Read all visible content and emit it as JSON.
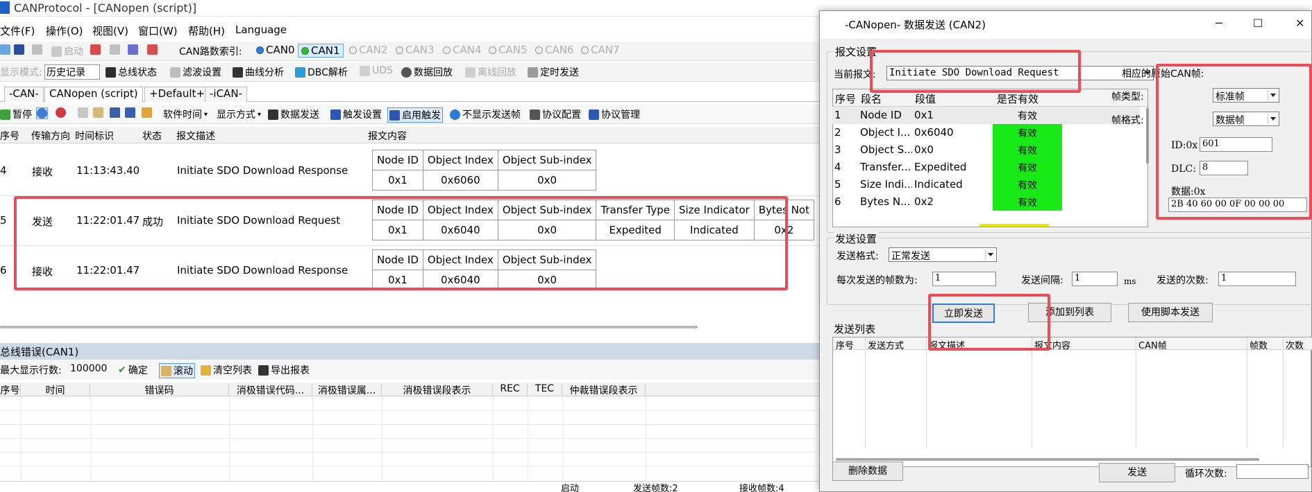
{
  "app": {
    "title": "CANProtocol - [CANopen (script)]"
  },
  "menu": {
    "file": "文件(F)",
    "operate": "操作(O)",
    "view": "视图(V)",
    "window": "窗口(W)",
    "help": "帮助(H)",
    "language": "Language"
  },
  "toolbar1": {
    "start": "启动",
    "can_index_label": "CAN路数索引:",
    "channels": [
      "CAN0",
      "CAN1",
      "CAN2",
      "CAN3",
      "CAN4",
      "CAN5",
      "CAN6",
      "CAN7"
    ]
  },
  "toolbar2": {
    "display_mode_label": "显示模式:",
    "display_mode_value": "历史记录",
    "bus_status": "总线状态",
    "filter": "滤波设置",
    "curve": "曲线分析",
    "dbc": "DBC解析",
    "uds": "UDS",
    "replay": "数据回放",
    "offline_replay": "离线回放",
    "timed_send": "定时发送"
  },
  "tabs": [
    "-CAN-",
    "CANopen (script)",
    "+Default+",
    "-iCAN-"
  ],
  "toolbar3": {
    "pause": "暂停",
    "soft_time": "软件时间",
    "display_method": "显示方式",
    "data_send": "数据发送",
    "trigger_settings": "触发设置",
    "enable_trigger": "启用触发",
    "hide_send_frames": "不显示发送帧",
    "protocol_config": "协议配置",
    "protocol_manage": "协议管理"
  },
  "main_table": {
    "headers": [
      "序号",
      "传输方向",
      "时间标识",
      "状态",
      "报文描述",
      "报文内容"
    ],
    "rows": [
      {
        "seq": "4",
        "dir": "接收",
        "time": "11:13:43.40",
        "status": "",
        "desc": "Initiate SDO Download Response",
        "fields": [
          "Node ID",
          "Object Index",
          "Object Sub-index"
        ],
        "values": [
          "0x1",
          "0x6060",
          "0x0"
        ]
      },
      {
        "seq": "5",
        "dir": "发送",
        "time": "11:22:01.47",
        "status": "成功",
        "desc": "Initiate SDO Download Request",
        "fields": [
          "Node ID",
          "Object Index",
          "Object Sub-index",
          "Transfer Type",
          "Size Indicator",
          "Bytes Not"
        ],
        "values": [
          "0x1",
          "0x6040",
          "0x0",
          "Expedited",
          "Indicated",
          "0x2"
        ]
      },
      {
        "seq": "6",
        "dir": "接收",
        "time": "11:22:01.47",
        "status": "",
        "desc": "Initiate SDO Download Response",
        "fields": [
          "Node ID",
          "Object Index",
          "Object Sub-index"
        ],
        "values": [
          "0x1",
          "0x6040",
          "0x0"
        ]
      }
    ]
  },
  "bus_error": {
    "title": "总线错误(CAN1)",
    "max_rows_label": "最大显示行数:",
    "max_rows_value": "100000",
    "confirm": "确定",
    "scroll": "滚动",
    "clear": "清空列表",
    "export": "导出报表",
    "headers": [
      "序号",
      "时间",
      "错误码",
      "消极错误代码...",
      "消极错误属...",
      "消极错误段表示",
      "REC",
      "TEC",
      "仲裁错误段表示"
    ]
  },
  "statusbar": {
    "state": "启动",
    "sent": "发送帧数:2",
    "recv": "接收帧数:4"
  },
  "dialog": {
    "title": "-CANopen- 数据发送 (CAN2)",
    "msg_settings": "报文设置",
    "current_msg_label": "当前报文:",
    "current_msg_value": "Initiate SDO Download Request",
    "seg_headers": [
      "序号",
      "段名",
      "段值",
      "是否有效"
    ],
    "segments": [
      {
        "no": "1",
        "name": "Node ID",
        "value": "0x1",
        "valid": "有效"
      },
      {
        "no": "2",
        "name": "Object I...",
        "value": "0x6040",
        "valid": "有效"
      },
      {
        "no": "3",
        "name": "Object S...",
        "value": "0x0",
        "valid": "有效"
      },
      {
        "no": "4",
        "name": "Transfer...",
        "value": "Expedited",
        "valid": "有效"
      },
      {
        "no": "5",
        "name": "Size Indi...",
        "value": "Indicated",
        "valid": "有效"
      },
      {
        "no": "6",
        "name": "Bytes N...",
        "value": "0x2",
        "valid": "有效"
      }
    ],
    "raw_frame": {
      "title": "相应的原始CAN帧:",
      "frame_type_label": "帧类型:",
      "frame_type_value": "标准帧",
      "frame_format_label": "帧格式:",
      "frame_format_value": "数据帧",
      "id_label": "ID:0x",
      "id_value": "601",
      "dlc_label": "DLC:",
      "dlc_value": "8",
      "data_label": "数据:0x",
      "data_value": "2B 40 60 00 0F 00 00 00"
    },
    "send_settings": {
      "title": "发送设置",
      "format_label": "发送格式:",
      "format_value": "正常发送",
      "frames_per_send_label": "每次发送的帧数为:",
      "frames_per_send_value": "1",
      "interval_label": "发送间隔:",
      "interval_value": "1",
      "interval_unit": "ms",
      "times_label": "发送的次数:",
      "times_value": "1"
    },
    "buttons": {
      "send_now": "立即发送",
      "add_to_list": "添加到列表",
      "script_send": "使用脚本发送"
    },
    "send_list": {
      "title": "发送列表",
      "headers": [
        "序号",
        "发送方式",
        "报文描述",
        "报文内容",
        "CAN帧",
        "帧数",
        "次数"
      ]
    },
    "bottom": {
      "delete": "删除数据",
      "send": "发送",
      "loop_label": "循环次数:",
      "loop_value": ""
    }
  },
  "colors": {
    "highlight_red": "#ec4c55",
    "valid_green": "#18ea18",
    "accent_blue": "#2c7fd0"
  }
}
